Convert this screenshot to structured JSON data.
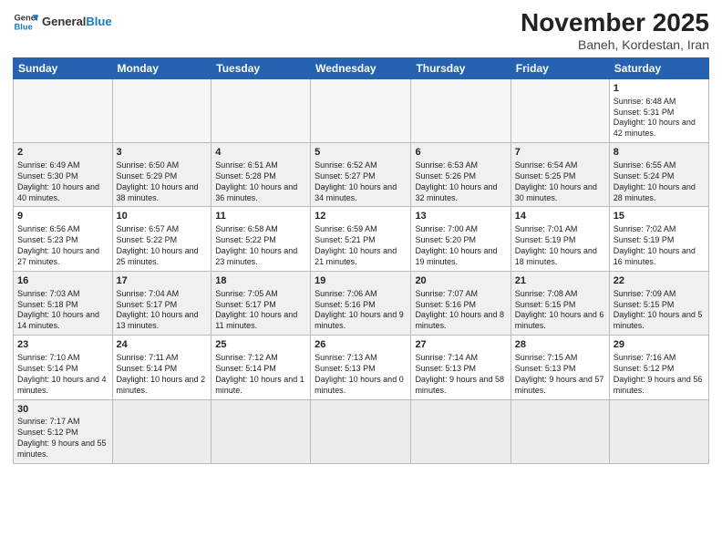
{
  "header": {
    "logo_general": "General",
    "logo_blue": "Blue",
    "month_title": "November 2025",
    "subtitle": "Baneh, Kordestan, Iran"
  },
  "weekdays": [
    "Sunday",
    "Monday",
    "Tuesday",
    "Wednesday",
    "Thursday",
    "Friday",
    "Saturday"
  ],
  "weeks": [
    [
      {
        "day": "",
        "info": ""
      },
      {
        "day": "",
        "info": ""
      },
      {
        "day": "",
        "info": ""
      },
      {
        "day": "",
        "info": ""
      },
      {
        "day": "",
        "info": ""
      },
      {
        "day": "",
        "info": ""
      },
      {
        "day": "1",
        "info": "Sunrise: 6:48 AM\nSunset: 5:31 PM\nDaylight: 10 hours\nand 42 minutes."
      }
    ],
    [
      {
        "day": "2",
        "info": "Sunrise: 6:49 AM\nSunset: 5:30 PM\nDaylight: 10 hours\nand 40 minutes."
      },
      {
        "day": "3",
        "info": "Sunrise: 6:50 AM\nSunset: 5:29 PM\nDaylight: 10 hours\nand 38 minutes."
      },
      {
        "day": "4",
        "info": "Sunrise: 6:51 AM\nSunset: 5:28 PM\nDaylight: 10 hours\nand 36 minutes."
      },
      {
        "day": "5",
        "info": "Sunrise: 6:52 AM\nSunset: 5:27 PM\nDaylight: 10 hours\nand 34 minutes."
      },
      {
        "day": "6",
        "info": "Sunrise: 6:53 AM\nSunset: 5:26 PM\nDaylight: 10 hours\nand 32 minutes."
      },
      {
        "day": "7",
        "info": "Sunrise: 6:54 AM\nSunset: 5:25 PM\nDaylight: 10 hours\nand 30 minutes."
      },
      {
        "day": "8",
        "info": "Sunrise: 6:55 AM\nSunset: 5:24 PM\nDaylight: 10 hours\nand 28 minutes."
      }
    ],
    [
      {
        "day": "9",
        "info": "Sunrise: 6:56 AM\nSunset: 5:23 PM\nDaylight: 10 hours\nand 27 minutes."
      },
      {
        "day": "10",
        "info": "Sunrise: 6:57 AM\nSunset: 5:22 PM\nDaylight: 10 hours\nand 25 minutes."
      },
      {
        "day": "11",
        "info": "Sunrise: 6:58 AM\nSunset: 5:22 PM\nDaylight: 10 hours\nand 23 minutes."
      },
      {
        "day": "12",
        "info": "Sunrise: 6:59 AM\nSunset: 5:21 PM\nDaylight: 10 hours\nand 21 minutes."
      },
      {
        "day": "13",
        "info": "Sunrise: 7:00 AM\nSunset: 5:20 PM\nDaylight: 10 hours\nand 19 minutes."
      },
      {
        "day": "14",
        "info": "Sunrise: 7:01 AM\nSunset: 5:19 PM\nDaylight: 10 hours\nand 18 minutes."
      },
      {
        "day": "15",
        "info": "Sunrise: 7:02 AM\nSunset: 5:19 PM\nDaylight: 10 hours\nand 16 minutes."
      }
    ],
    [
      {
        "day": "16",
        "info": "Sunrise: 7:03 AM\nSunset: 5:18 PM\nDaylight: 10 hours\nand 14 minutes."
      },
      {
        "day": "17",
        "info": "Sunrise: 7:04 AM\nSunset: 5:17 PM\nDaylight: 10 hours\nand 13 minutes."
      },
      {
        "day": "18",
        "info": "Sunrise: 7:05 AM\nSunset: 5:17 PM\nDaylight: 10 hours\nand 11 minutes."
      },
      {
        "day": "19",
        "info": "Sunrise: 7:06 AM\nSunset: 5:16 PM\nDaylight: 10 hours\nand 9 minutes."
      },
      {
        "day": "20",
        "info": "Sunrise: 7:07 AM\nSunset: 5:16 PM\nDaylight: 10 hours\nand 8 minutes."
      },
      {
        "day": "21",
        "info": "Sunrise: 7:08 AM\nSunset: 5:15 PM\nDaylight: 10 hours\nand 6 minutes."
      },
      {
        "day": "22",
        "info": "Sunrise: 7:09 AM\nSunset: 5:15 PM\nDaylight: 10 hours\nand 5 minutes."
      }
    ],
    [
      {
        "day": "23",
        "info": "Sunrise: 7:10 AM\nSunset: 5:14 PM\nDaylight: 10 hours\nand 4 minutes."
      },
      {
        "day": "24",
        "info": "Sunrise: 7:11 AM\nSunset: 5:14 PM\nDaylight: 10 hours\nand 2 minutes."
      },
      {
        "day": "25",
        "info": "Sunrise: 7:12 AM\nSunset: 5:14 PM\nDaylight: 10 hours\nand 1 minute."
      },
      {
        "day": "26",
        "info": "Sunrise: 7:13 AM\nSunset: 5:13 PM\nDaylight: 10 hours\nand 0 minutes."
      },
      {
        "day": "27",
        "info": "Sunrise: 7:14 AM\nSunset: 5:13 PM\nDaylight: 9 hours\nand 58 minutes."
      },
      {
        "day": "28",
        "info": "Sunrise: 7:15 AM\nSunset: 5:13 PM\nDaylight: 9 hours\nand 57 minutes."
      },
      {
        "day": "29",
        "info": "Sunrise: 7:16 AM\nSunset: 5:12 PM\nDaylight: 9 hours\nand 56 minutes."
      }
    ],
    [
      {
        "day": "30",
        "info": "Sunrise: 7:17 AM\nSunset: 5:12 PM\nDaylight: 9 hours\nand 55 minutes."
      },
      {
        "day": "",
        "info": ""
      },
      {
        "day": "",
        "info": ""
      },
      {
        "day": "",
        "info": ""
      },
      {
        "day": "",
        "info": ""
      },
      {
        "day": "",
        "info": ""
      },
      {
        "day": "",
        "info": ""
      }
    ]
  ]
}
